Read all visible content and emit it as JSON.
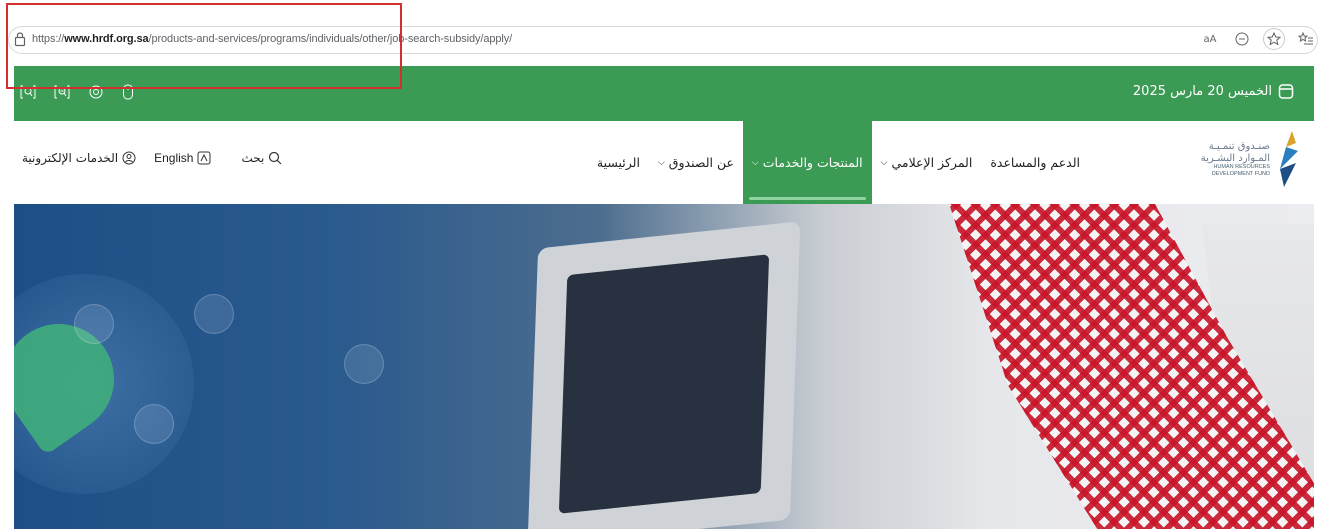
{
  "browser": {
    "url_prefix": "https://",
    "url_domain": "www.hrdf.org.sa",
    "url_path": "/products-and-services/programs/individuals/other/job-search-subsidy/apply/",
    "read_aloud_label": "aA",
    "icons": [
      "lock-icon",
      "zoom-icon",
      "star-icon",
      "favorites-icon"
    ]
  },
  "topbar": {
    "date": "الخميس 20 مارس 2025",
    "icons": [
      "text-decrease-icon",
      "text-increase-icon",
      "eye-icon",
      "mouse-icon",
      "calendar-icon"
    ],
    "color": "#3b9a54"
  },
  "nav": {
    "search_label": "بحث",
    "language_label": "English",
    "eservices_label": "الخدمات الإلكترونية",
    "menu": [
      {
        "label": "الرئيسية",
        "has_dropdown": false,
        "active": false
      },
      {
        "label": "عن الصندوق",
        "has_dropdown": true,
        "active": false
      },
      {
        "label": "المنتجات والخدمات",
        "has_dropdown": true,
        "active": true
      },
      {
        "label": "المركز الإعلامي",
        "has_dropdown": true,
        "active": false
      },
      {
        "label": "الدعم والمساعدة",
        "has_dropdown": false,
        "active": false
      }
    ],
    "logo": {
      "ar_line1": "صنـدوق تنمـيـة",
      "ar_line2": "المـوارد البشـرية",
      "en_line1": "HUMAN RESOURCES",
      "en_line2": "DEVELOPMENT FUND"
    }
  },
  "colors": {
    "brand_green": "#3b9a54",
    "highlight_red": "#d32f2f"
  }
}
